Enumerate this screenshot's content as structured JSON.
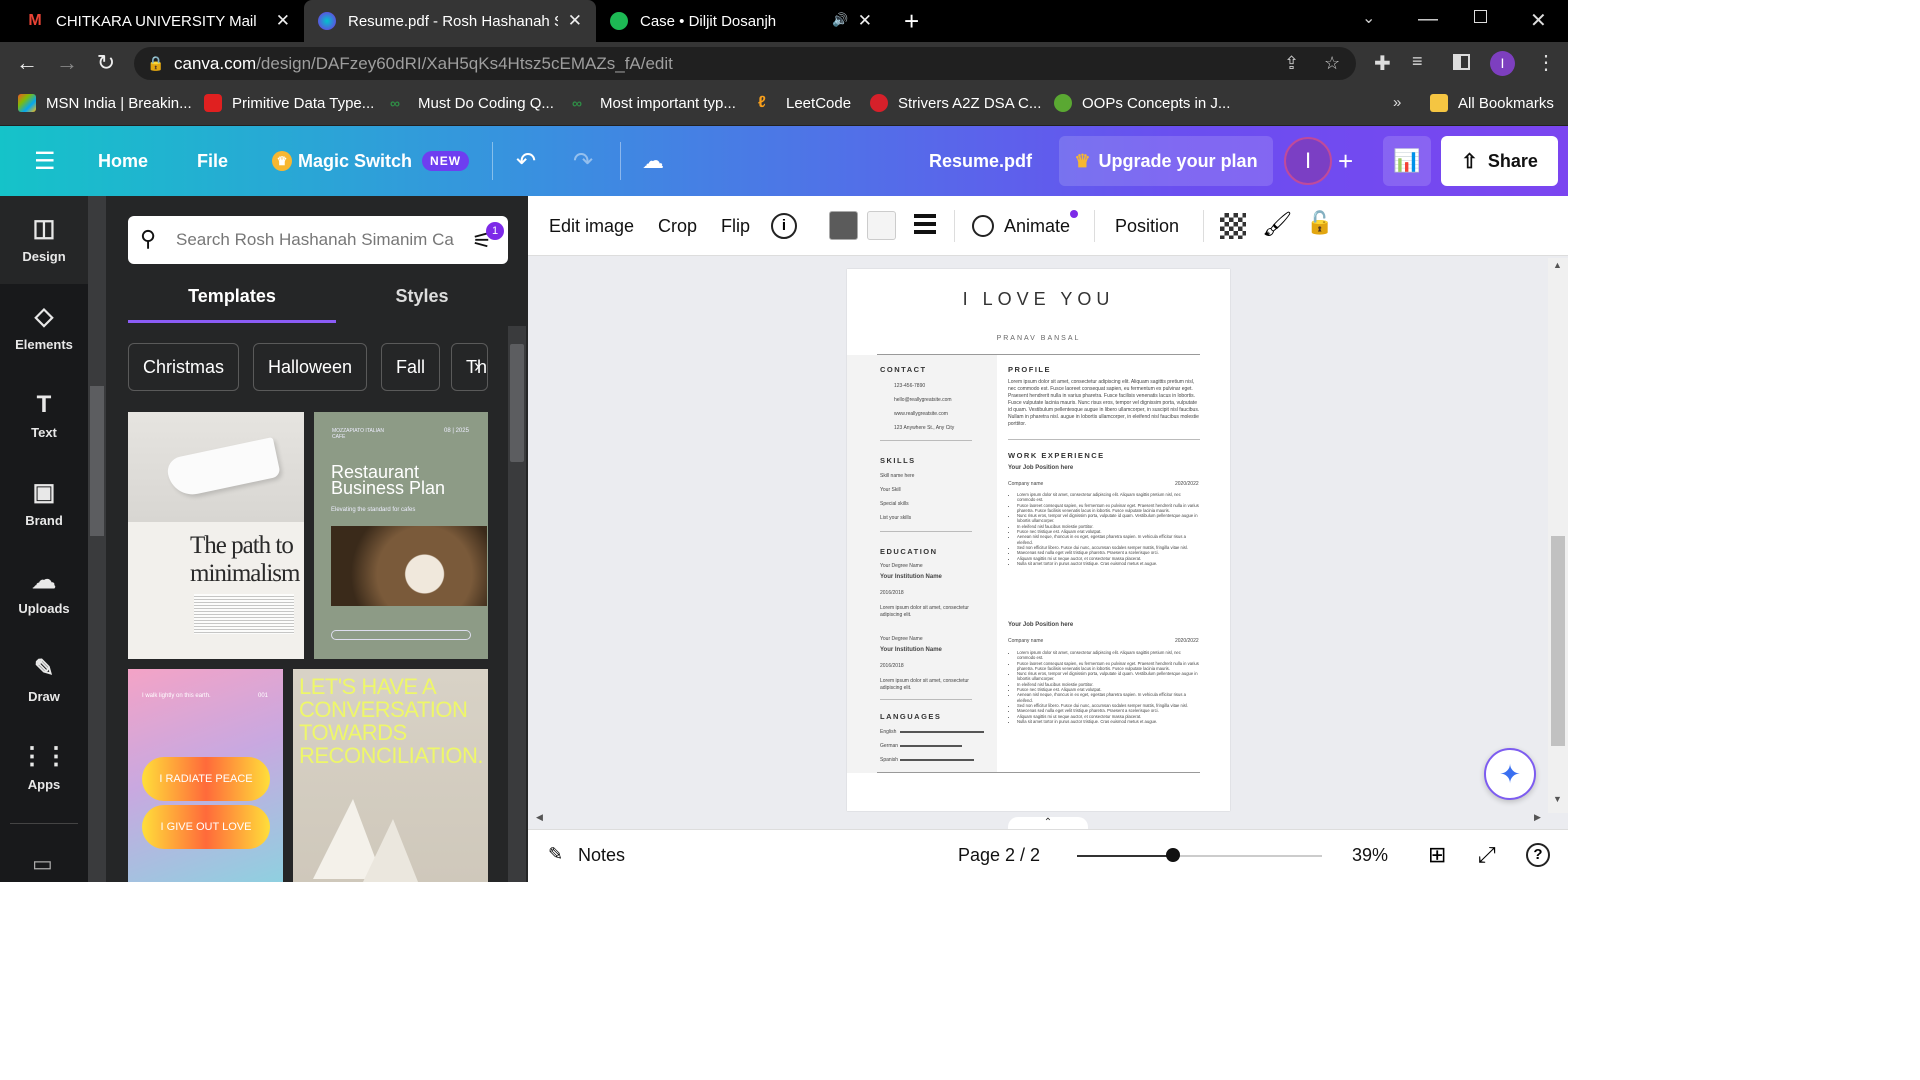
{
  "browser": {
    "tabs": [
      {
        "title": "CHITKARA UNIVERSITY Mail",
        "icon": "gmail-icon",
        "color": "#ea4335"
      },
      {
        "title": "Resume.pdf - Rosh Hashanah Sir",
        "icon": "canva-icon",
        "color": "#7d2ae8"
      },
      {
        "title": "Case • Diljit Dosanjh",
        "icon": "spotify-icon",
        "color": "#1db954"
      }
    ],
    "url_host": "canva.com",
    "url_path": "/design/DAFzey60dRI/XaH5qKs4Htsz5cEMAZs_fA/edit",
    "bookmarks": [
      "MSN India | Breakin...",
      "Primitive Data Type...",
      "Must Do Coding Q...",
      "Most important typ...",
      "LeetCode",
      "Strivers A2Z DSA C...",
      "OOPs Concepts in J...",
      "All Bookmarks"
    ],
    "profile_initial": "I"
  },
  "canva": {
    "home": "Home",
    "file": "File",
    "magic_switch": "Magic Switch",
    "new_badge": "NEW",
    "doc_title": "Resume.pdf",
    "upgrade": "Upgrade your plan",
    "avatar": "I",
    "share": "Share",
    "sidebar": [
      "Design",
      "Elements",
      "Text",
      "Brand",
      "Uploads",
      "Draw",
      "Apps"
    ],
    "search_placeholder": "Search Rosh Hashanah Simanim Ca",
    "filter_count": "1",
    "panel_tabs": [
      "Templates",
      "Styles"
    ],
    "chips": [
      "Christmas",
      "Halloween",
      "Fall",
      "Th"
    ],
    "thumbs": {
      "t1_title1": "The path to",
      "t1_title2": "minimalism",
      "t2_brand": "MOZZAPIATO ITALIAN CAFE",
      "t2_date": "08 | 2025",
      "t2_title1": "Restaurant",
      "t2_title2": "Business Plan",
      "t2_sub": "Elevating the standard for cafes",
      "t3_top": "I walk lightly on this earth.",
      "t3_num": "001",
      "t3_line1": "I RADIATE PEACE",
      "t3_line2": "I GIVE OUT LOVE",
      "t4_text": "LET'S HAVE A CONVERSATION TOWARDS RECONCILIATION."
    },
    "toolbar": {
      "edit_image": "Edit image",
      "crop": "Crop",
      "flip": "Flip",
      "animate": "Animate",
      "position": "Position"
    },
    "footer": {
      "notes": "Notes",
      "page": "Page 2 / 2",
      "zoom": "39%",
      "zoom_level": 0.39
    }
  },
  "resume": {
    "name": "I LOVE YOU",
    "subtitle": "PRANAV BANSAL",
    "contact_h": "CONTACT",
    "contact": [
      "123-456-7890",
      "hello@reallygreatsite.com",
      "www.reallygreatsite.com",
      "123 Anywhere St., Any City"
    ],
    "skills_h": "SKILLS",
    "skills": [
      "Skill name here",
      "Your Skill",
      "Special skills",
      "List your skills"
    ],
    "education_h": "EDUCATION",
    "edu": [
      {
        "degree": "Your Degree Name",
        "inst": "Your Institution Name",
        "years": "2016/2018",
        "desc": "Lorem ipsum dolor sit amet, consectetur adipiscing elit."
      },
      {
        "degree": "Your Degree Name",
        "inst": "Your Institution Name",
        "years": "2016/2018",
        "desc": "Lorem ipsum dolor sit amet, consectetur adipiscing elit."
      }
    ],
    "languages_h": "LANGUAGES",
    "languages": [
      "English",
      "German",
      "Spanish"
    ],
    "profile_h": "PROFILE",
    "profile": "Lorem ipsum dolor sit amet, consectetur adipiscing elit. Aliquam sagittis pretium nisl, nec commodo est. Fusce laoreet consequat sapien, eu fermentum ex pulvinar eget. Praesent hendrerit nulla in varius pharetra. Fusce facilisis venenatis lacus in lobortis. Fusce vulputate lacinia mauris. Nunc risus eros, tempor vel dignissim porta, vulputate id quam. Vestibulum pellentesque augue in libero ullamcorper, in suscipit nisl faucibus. Nullam in pharetra nisl. augue in lobortis ullamcorper, in eleifend nisl faucibus molestie porttitor.",
    "work_h": "WORK EXPERIENCE",
    "jobs": [
      {
        "title": "Your Job Position here",
        "company": "Company name",
        "years": "2020/2022"
      },
      {
        "title": "Your Job Position here",
        "company": "Company name",
        "years": "2020/2022"
      }
    ],
    "bullets": [
      "Lorem ipsum dolor sit amet, consectetur adipiscing elit. Aliquam sagittis pretium nisl, nec commodo est.",
      "Fusce laoreet consequat sapien, eu fermentum ex pulvinar eget. Praesent hendrerit nulla in varius pharetra. Fusce facilisis venenatis lacus in lobortis. Fusce vulputate lacinia mauris.",
      "Nunc risus eros, tempor vel dignissim porta, vulputate id quam. Vestibulum pellentesque augue in lobortis ullamcorper.",
      "In eleifend nisl faucibus molestie porttitor.",
      "Fusce nec tristique est. Aliquam erat volutpat.",
      "Aenean nisl neque, rhoncus in ex eget, egestas pharetra sapien. In vehicula efficitur risus a eleifend.",
      "Sed non efficitur libero. Fusce dui nunc, accumsan sodales semper mattis, fringilla vitae nisl.",
      "Maecenas sed nulla eget velit tristique pharetra. Praesent a scelerisque orci.",
      "Aliquam sagittis mi ut neque auctor, et consectetur massa placerat.",
      "Nulla sit amet tortor in purus auctor tristique. Cras euismod metus et augue."
    ]
  }
}
